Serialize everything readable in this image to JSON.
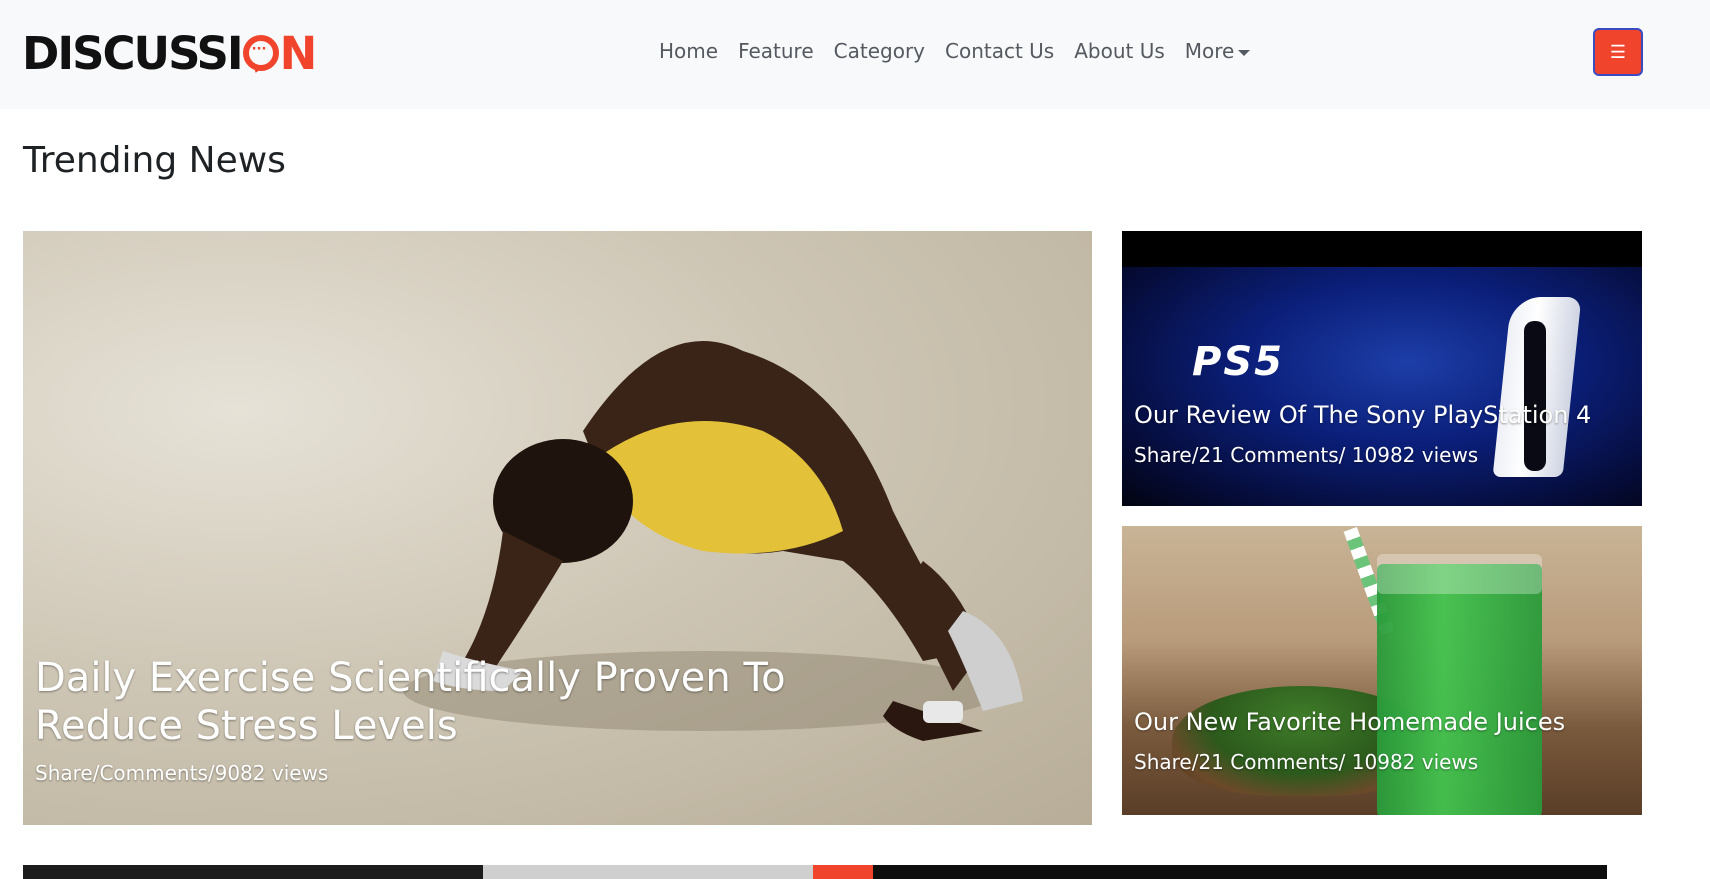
{
  "brand": {
    "logo_text_prefix": "DISCUSSI",
    "logo_text_suffix": "N",
    "accent_color": "#f0442c"
  },
  "nav": {
    "links": [
      "Home",
      "Feature",
      "Category",
      "Contact Us",
      "About Us"
    ],
    "more_label": "More",
    "menu_icon": "hamburger-icon"
  },
  "section": {
    "title": "Trending News"
  },
  "cards": {
    "main": {
      "title": "Daily Exercise Scientifically Proven To Reduce Stress Levels",
      "meta": "Share/Comments/9082 views"
    },
    "ps5": {
      "logo_text": "PS5",
      "title": "Our Review Of The Sony PlayStation 4",
      "meta": "Share/21 Comments/ 10982 views"
    },
    "juice": {
      "title": "Our New Favorite Homemade Juices",
      "meta": "Share/21 Comments/ 10982 views"
    }
  }
}
